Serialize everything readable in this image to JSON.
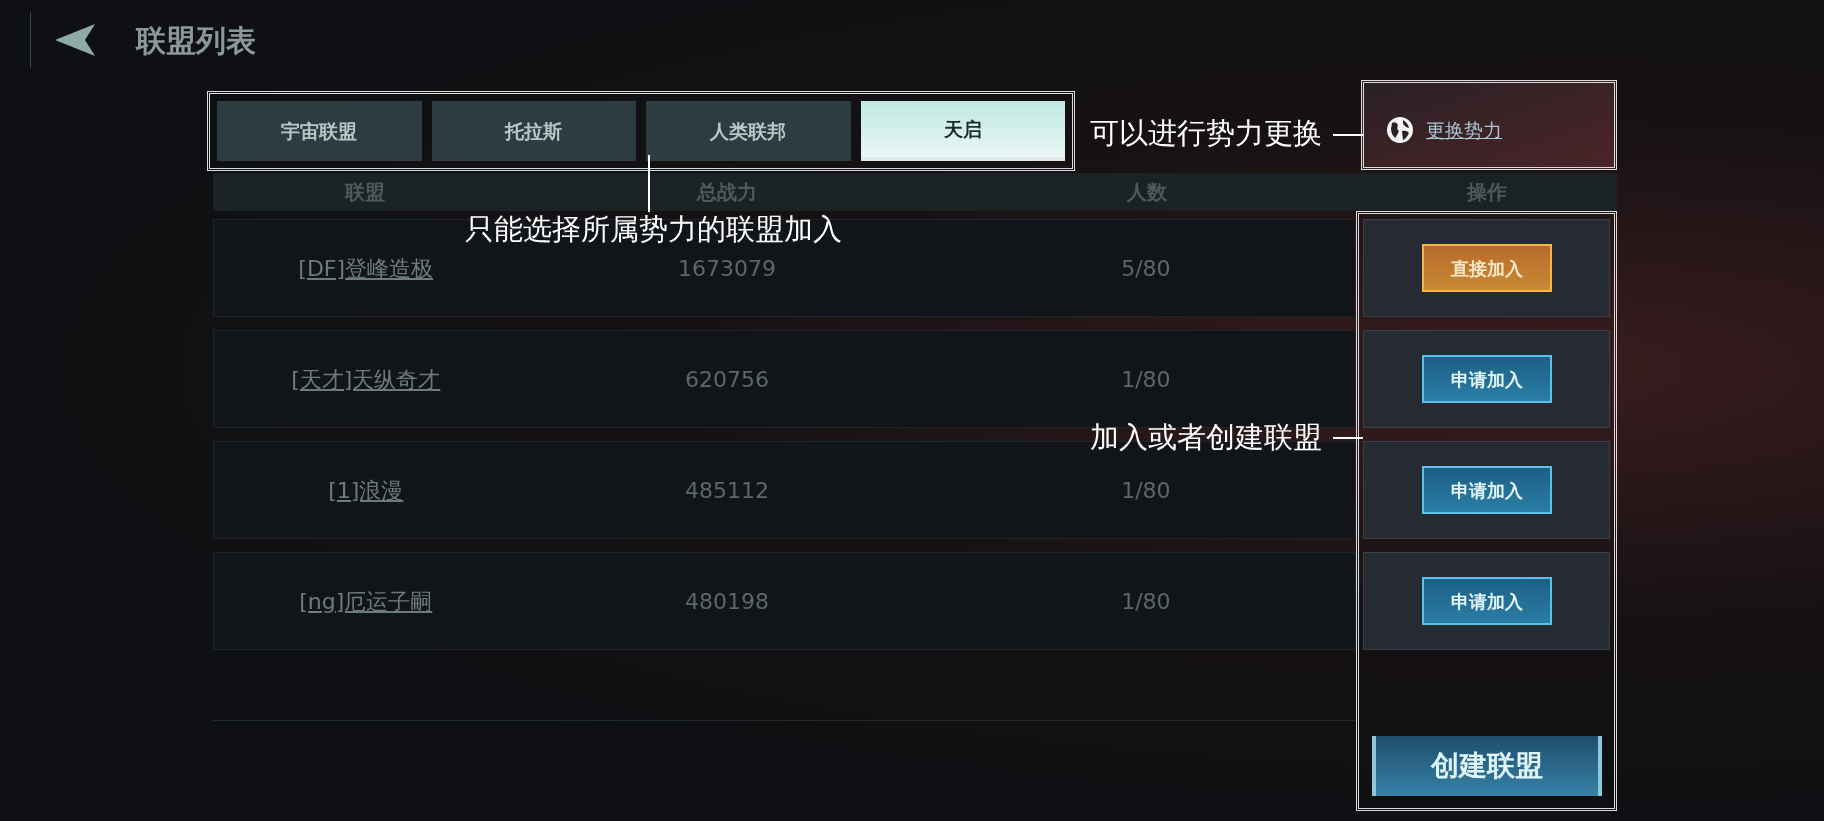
{
  "header": {
    "title": "联盟列表"
  },
  "tabs": [
    {
      "label": "宇宙联盟",
      "selected": false
    },
    {
      "label": "托拉斯",
      "selected": false
    },
    {
      "label": "人类联邦",
      "selected": false
    },
    {
      "label": "天启",
      "selected": true
    }
  ],
  "tabs_note": "只能选择所属势力的联盟加入",
  "faction_change": {
    "link": "更换势力",
    "note": "可以进行势力更换"
  },
  "table": {
    "columns": [
      "联盟",
      "总战力",
      "人数",
      "操作"
    ],
    "rows": [
      {
        "name": "[DF]登峰造极",
        "power": "1673079",
        "members": "5/80",
        "action": {
          "kind": "direct",
          "label": "直接加入"
        }
      },
      {
        "name": "[天才]天纵奇才",
        "power": "620756",
        "members": "1/80",
        "action": {
          "kind": "apply",
          "label": "申请加入"
        }
      },
      {
        "name": "[1]浪漫",
        "power": "485112",
        "members": "1/80",
        "action": {
          "kind": "apply",
          "label": "申请加入"
        }
      },
      {
        "name": "[ng]厄运子嗣",
        "power": "480198",
        "members": "1/80",
        "action": {
          "kind": "apply",
          "label": "申请加入"
        }
      }
    ]
  },
  "actions_note": "加入或者创建联盟",
  "create_button": "创建联盟"
}
